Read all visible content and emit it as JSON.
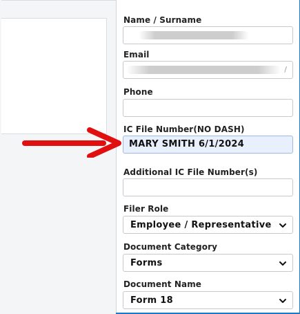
{
  "form": {
    "name_label": "Name / Surname",
    "email_label": "Email",
    "email_tail": "/",
    "phone_label": "Phone",
    "ic_file_label": "IC File Number(NO DASH)",
    "ic_file_value": "MARY SMITH 6/1/2024",
    "additional_ic_label": "Additional IC File Number(s)",
    "filer_role_label": "Filer Role",
    "filer_role_value": "Employee / Representative",
    "doc_category_label": "Document Category",
    "doc_category_value": "Forms",
    "doc_name_label": "Document Name",
    "doc_name_value": "Form 18"
  },
  "colors": {
    "frame_border": "#1e78c8",
    "arrow": "#e01010",
    "highlight_field": "#e8f0fe"
  }
}
